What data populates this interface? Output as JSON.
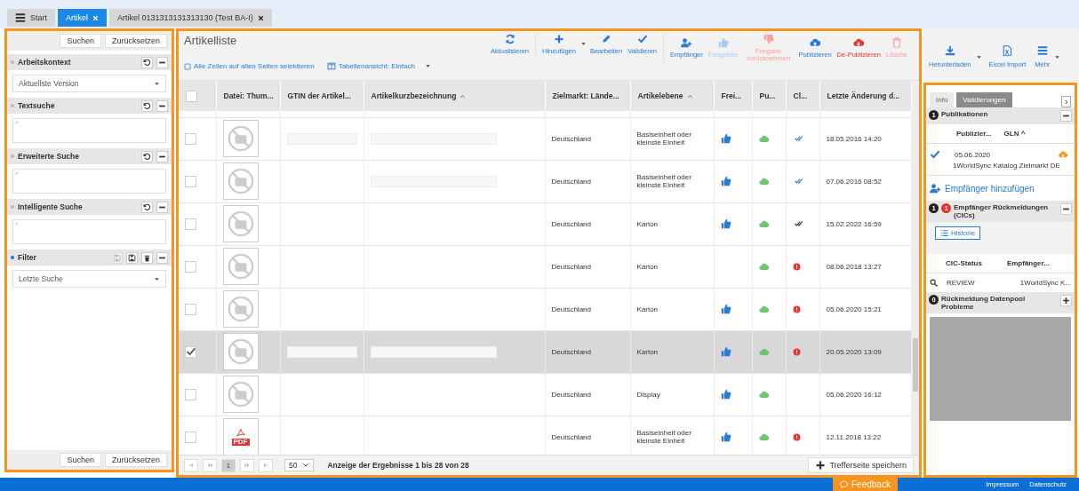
{
  "tabs": [
    {
      "label": "Start",
      "selected": false,
      "closable": false
    },
    {
      "label": "Artikel",
      "selected": true,
      "closable": true
    },
    {
      "label": "Artikel 0131313131313130 (Test BA-I)",
      "selected": false,
      "closable": true
    }
  ],
  "search_panel": {
    "top_buttons": [
      "Suchen",
      "Zurücksetzen"
    ],
    "sections": [
      {
        "title": "Arbeitskontext",
        "active": false,
        "kind": "reset",
        "field": {
          "kind": "select",
          "value": "Aktuellste Version"
        }
      },
      {
        "title": "Textsuche",
        "active": false,
        "kind": "reset",
        "field": {
          "kind": "textarea"
        }
      },
      {
        "title": "Erweiterte Suche",
        "active": false,
        "kind": "reset",
        "field": {
          "kind": "textarea"
        }
      },
      {
        "title": "Intelligente Suche",
        "active": false,
        "kind": "reset",
        "field": {
          "kind": "textarea"
        }
      },
      {
        "title": "Filter",
        "active": true,
        "kind": "filter",
        "field": {
          "kind": "select",
          "value": "Letzte Suche"
        }
      }
    ],
    "bottom_buttons": [
      "Suchen",
      "Zurücksetzen"
    ]
  },
  "list": {
    "title": "Artikelliste",
    "select_all_link": "Alle Zeilen auf allen Seiten selektieren",
    "view_link": "Tabellenansicht: Einfach",
    "toolbar": [
      [
        {
          "label": "Aktualisieren",
          "kind": "primary",
          "disabled": false,
          "dropdown": false
        }
      ],
      [
        {
          "label": "Hinzufügen",
          "kind": "primary",
          "disabled": false,
          "dropdown": true
        },
        {
          "label": "Bearbeiten",
          "kind": "primary",
          "disabled": false,
          "dropdown": false
        },
        {
          "label": "Validieren",
          "kind": "primary",
          "disabled": false,
          "dropdown": false
        }
      ],
      [
        {
          "label": "Empfänger",
          "kind": "primary",
          "disabled": false,
          "dropdown": false
        },
        {
          "label": "Freigeben",
          "kind": "primary",
          "disabled": true,
          "dropdown": false
        },
        {
          "label": "Freigabe zurücknehmen",
          "kind": "danger",
          "disabled": true,
          "dropdown": false
        },
        {
          "label": "Publizieren",
          "kind": "primary",
          "disabled": false,
          "dropdown": false
        },
        {
          "label": "De-Publizieren",
          "kind": "danger",
          "disabled": false,
          "dropdown": false
        },
        {
          "label": "Lösche",
          "kind": "danger",
          "disabled": true,
          "dropdown": false
        }
      ]
    ],
    "columns": [
      {
        "label": "Datei: Thum...",
        "sorted": false
      },
      {
        "label": "GTIN der Artikel...",
        "sorted": false
      },
      {
        "label": "Artikelkurzbezeichnung",
        "sorted": true
      },
      {
        "label": "Zielmarkt: Lände...",
        "sorted": false
      },
      {
        "label": "Artikelebene",
        "sorted": true
      },
      {
        "label": "Frei...",
        "sorted": false
      },
      {
        "label": "Pu...",
        "sorted": false
      },
      {
        "label": "Cl...",
        "sorted": false
      },
      {
        "label": "Letzte Änderung d...",
        "sorted": false
      }
    ],
    "header_checked": false,
    "rows": [
      {
        "selected": false,
        "checked": false,
        "thumbnail": {
          "kind": "placeholder"
        },
        "gtin_redacted": true,
        "name_redacted": true,
        "zielmarkt": "Deutschland",
        "artikelebene": "Basiseinheit oder kleinste Einheit",
        "released": true,
        "published": true,
        "cic": {
          "kind": "confirmed"
        },
        "changed": "18.05.2016 14:20"
      },
      {
        "selected": false,
        "checked": false,
        "thumbnail": {
          "kind": "placeholder"
        },
        "gtin_redacted": false,
        "name_redacted": true,
        "zielmarkt": "Deutschland",
        "artikelebene": "Basiseinheit oder kleinste Einheit",
        "released": true,
        "published": true,
        "cic": {
          "kind": "confirmed"
        },
        "changed": "07.06.2016 08:52"
      },
      {
        "selected": false,
        "checked": false,
        "thumbnail": {
          "kind": "placeholder"
        },
        "gtin_redacted": false,
        "name_redacted": false,
        "zielmarkt": "Deutschland",
        "artikelebene": "Karton",
        "released": true,
        "published": true,
        "cic": {
          "kind": "accepted"
        },
        "changed": "15.02.2022 16:59"
      },
      {
        "selected": false,
        "checked": false,
        "thumbnail": {
          "kind": "placeholder"
        },
        "gtin_redacted": false,
        "name_redacted": false,
        "zielmarkt": "Deutschland",
        "artikelebene": "Karton",
        "released": false,
        "published": true,
        "cic": {
          "kind": "error"
        },
        "changed": "08.06.2018 13:27"
      },
      {
        "selected": false,
        "checked": false,
        "thumbnail": {
          "kind": "placeholder"
        },
        "gtin_redacted": false,
        "name_redacted": false,
        "zielmarkt": "Deutschland",
        "artikelebene": "Karton",
        "released": true,
        "published": true,
        "cic": {
          "kind": "error"
        },
        "changed": "05.06.2020 15:21"
      },
      {
        "selected": true,
        "checked": true,
        "thumbnail": {
          "kind": "placeholder"
        },
        "gtin_redacted": true,
        "name_redacted": true,
        "zielmarkt": "Deutschland",
        "artikelebene": "Karton",
        "released": true,
        "published": true,
        "cic": {
          "kind": "error"
        },
        "changed": "20.05.2020 13:09"
      },
      {
        "selected": false,
        "checked": false,
        "thumbnail": {
          "kind": "placeholder"
        },
        "gtin_redacted": false,
        "name_redacted": false,
        "zielmarkt": "Deutschland",
        "artikelebene": "Display",
        "released": true,
        "published": true,
        "cic": {
          "kind": "none"
        },
        "changed": "05.06.2020 16:12"
      },
      {
        "selected": false,
        "checked": false,
        "thumbnail": {
          "kind": "pdf",
          "label": "PDF"
        },
        "gtin_redacted": false,
        "name_redacted": false,
        "zielmarkt": "Deutschland",
        "artikelebene": "Basiseinheit oder kleinste Einheit",
        "released": true,
        "published": true,
        "cic": {
          "kind": "error"
        },
        "changed": "12.11.2018 13:22"
      }
    ],
    "pager": {
      "current_page": "1",
      "page_size": "50",
      "summary": "Anzeige der Ergebnisse 1 bis 28 von 28",
      "save_button": "Trefferseite speichern"
    }
  },
  "side_toolbar": [
    {
      "label": "Herunterladen",
      "dropdown": true
    },
    {
      "label": "Excel Import",
      "dropdown": false
    },
    {
      "label": "Mehr",
      "dropdown": true
    }
  ],
  "detail_panel": {
    "tabs": [
      {
        "label": "Info",
        "selected": false
      },
      {
        "label": "Validierungen",
        "selected": true
      }
    ],
    "publications": {
      "badge": "1",
      "title": "Publikationen",
      "columns": [
        "Publizier...",
        "GLN ^"
      ],
      "rows": [
        {
          "date": "05.06.2020",
          "recipient": "1WorldSync Katalog Zielmarkt DE"
        }
      ],
      "add_link": "Empfänger hinzufügen"
    },
    "cics": {
      "badge": "1",
      "alert_badge": "1",
      "title": "Empfänger Rückmeldungen (CICs)",
      "history_button": "Historie",
      "columns": [
        "CIC-Status",
        "Empfänger..."
      ],
      "rows": [
        {
          "status": "REVIEW",
          "recipient": "1WorldSync K..."
        }
      ]
    },
    "datapool": {
      "badge": "0",
      "title": "Rückmeldung Datenpool Probleme"
    }
  },
  "footer": {
    "feedback": "Feedback",
    "links": [
      "Impressum",
      "Datenschutz"
    ]
  }
}
